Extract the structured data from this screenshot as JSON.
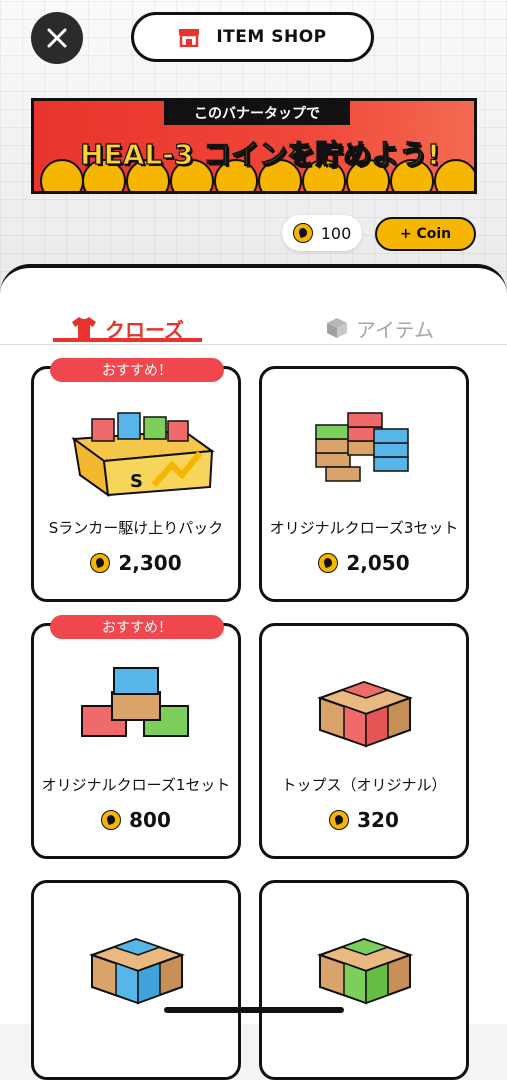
{
  "header": {
    "title": "ITEM SHOP"
  },
  "banner": {
    "top_text": "このバナータップで",
    "main_text": "HEAL-3 コインを貯めよう!"
  },
  "wallet": {
    "balance": "100",
    "add_coin_label": "+ Coin"
  },
  "tabs": [
    {
      "label": "クローズ",
      "icon": "shirt-icon",
      "active": true
    },
    {
      "label": "アイテム",
      "icon": "cube-icon",
      "active": false
    }
  ],
  "products": [
    {
      "name": "Sランカー駆け上りパック",
      "price": "2,300",
      "badge": "おすすめ！"
    },
    {
      "name": "オリジナルクローズ3セット",
      "price": "2,050",
      "badge": ""
    },
    {
      "name": "オリジナルクローズ1セット",
      "price": "800",
      "badge": "おすすめ！"
    },
    {
      "name": "トップス（オリジナル）",
      "price": "320",
      "badge": ""
    },
    {
      "name": "",
      "price": "",
      "badge": ""
    },
    {
      "name": "",
      "price": "",
      "badge": ""
    }
  ],
  "colors": {
    "accent": "#e8342c",
    "coin": "#f6b500",
    "badge": "#f0464e",
    "inactive": "#a7a7a7"
  }
}
